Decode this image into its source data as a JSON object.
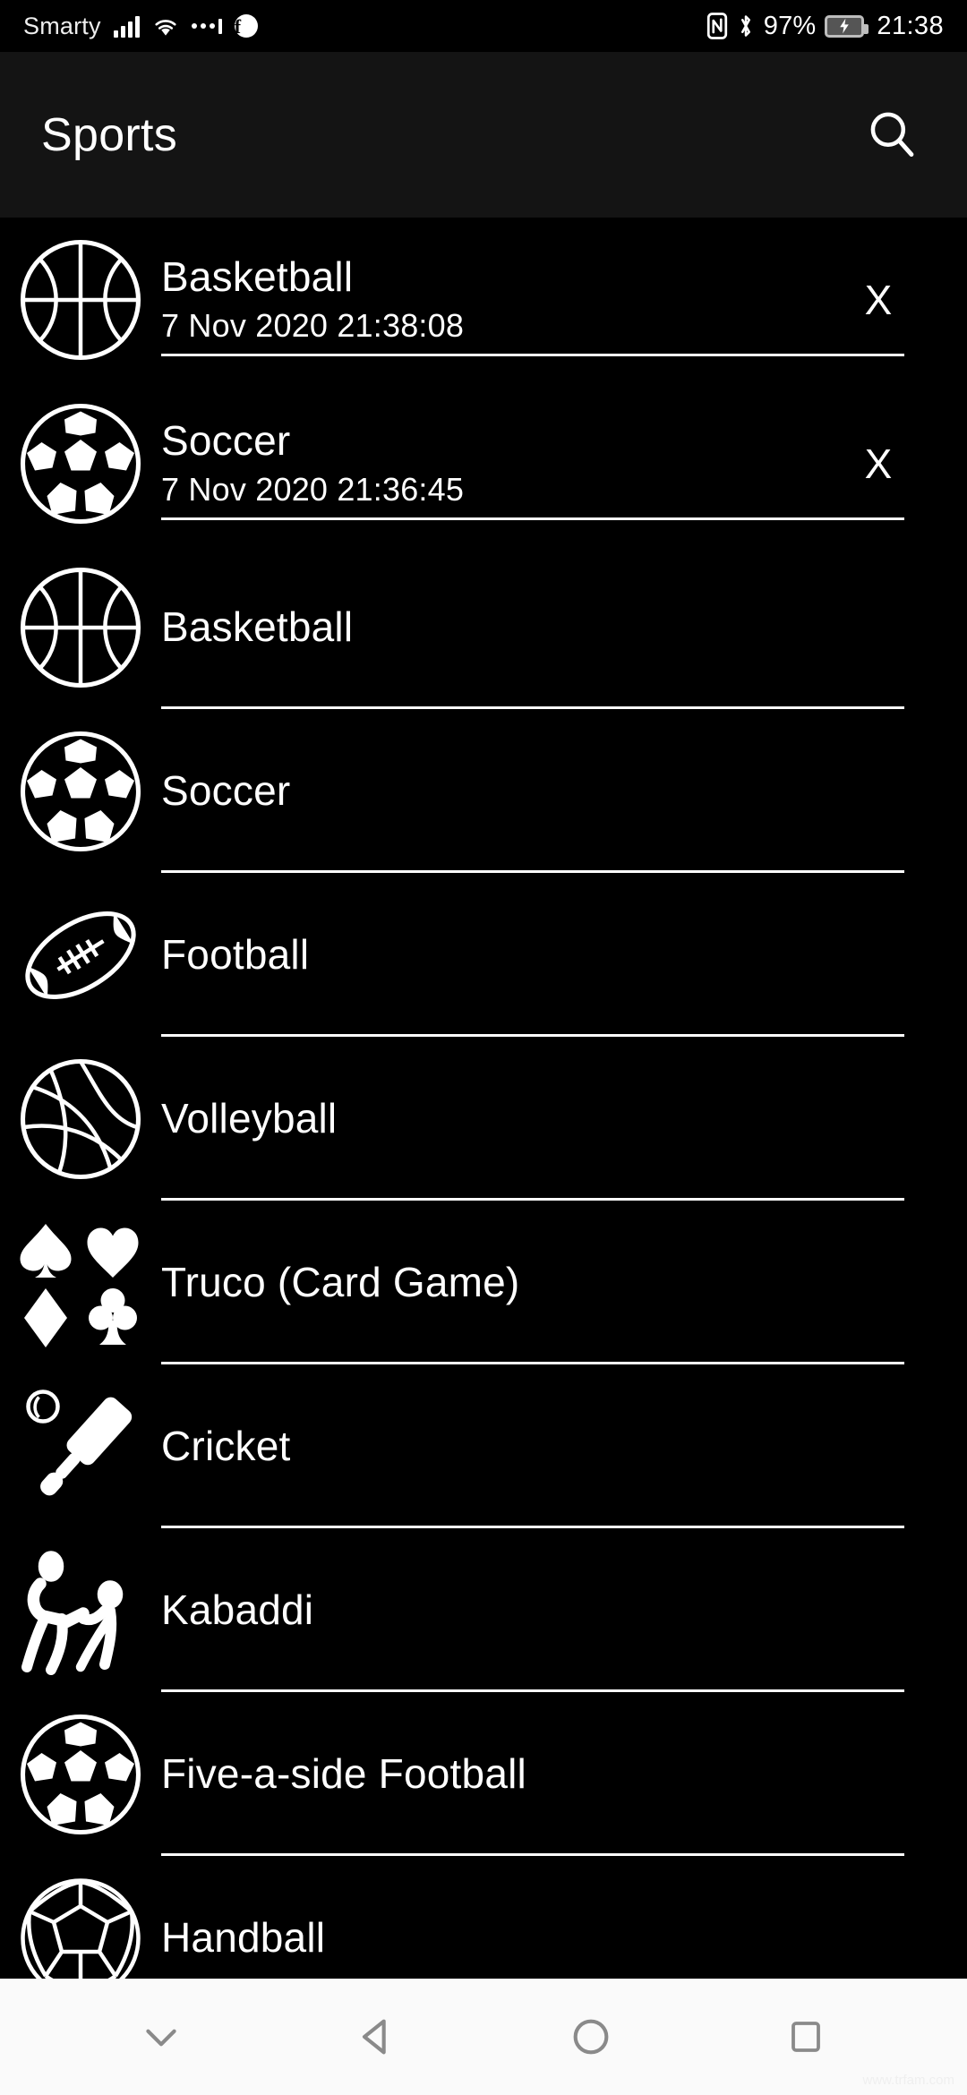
{
  "status_bar": {
    "carrier": "Smarty",
    "battery_percent": "97%",
    "clock": "21:38",
    "icons": [
      "signal-icon",
      "wifi-icon",
      "mobile-data-icon",
      "facebook-icon",
      "nfc-icon",
      "bluetooth-icon",
      "battery-charging-icon"
    ]
  },
  "app_bar": {
    "title": "Sports",
    "search_icon": "search-icon"
  },
  "list": {
    "items": [
      {
        "title": "Basketball",
        "timestamp": "7 Nov 2020 21:38:08",
        "icon": "basketball-icon",
        "delete_label": "X"
      },
      {
        "title": "Soccer",
        "timestamp": "7 Nov 2020 21:36:45",
        "icon": "soccer-ball-icon",
        "delete_label": "X"
      },
      {
        "title": "Basketball",
        "timestamp": "",
        "icon": "basketball-icon",
        "delete_label": ""
      },
      {
        "title": "Soccer",
        "timestamp": "",
        "icon": "soccer-ball-icon",
        "delete_label": ""
      },
      {
        "title": "Football",
        "timestamp": "",
        "icon": "american-football-icon",
        "delete_label": ""
      },
      {
        "title": "Volleyball",
        "timestamp": "",
        "icon": "volleyball-icon",
        "delete_label": ""
      },
      {
        "title": "Truco (Card Game)",
        "timestamp": "",
        "icon": "card-suits-icon",
        "delete_label": ""
      },
      {
        "title": "Cricket",
        "timestamp": "",
        "icon": "cricket-bat-icon",
        "delete_label": ""
      },
      {
        "title": "Kabaddi",
        "timestamp": "",
        "icon": "kabaddi-icon",
        "delete_label": ""
      },
      {
        "title": "Five-a-side Football",
        "timestamp": "",
        "icon": "soccer-ball-icon",
        "delete_label": ""
      },
      {
        "title": "Handball",
        "timestamp": "",
        "icon": "handball-icon",
        "delete_label": ""
      }
    ]
  },
  "nav_bar": {
    "buttons": [
      "hide-keyboard-icon",
      "back-icon",
      "home-icon",
      "recents-icon"
    ]
  },
  "watermark": "www.trfam.com",
  "colors": {
    "background": "#000000",
    "app_bar": "#141414",
    "foreground": "#ffffff",
    "nav_bar": "#fafafa",
    "nav_icon": "#8a8a8a"
  }
}
